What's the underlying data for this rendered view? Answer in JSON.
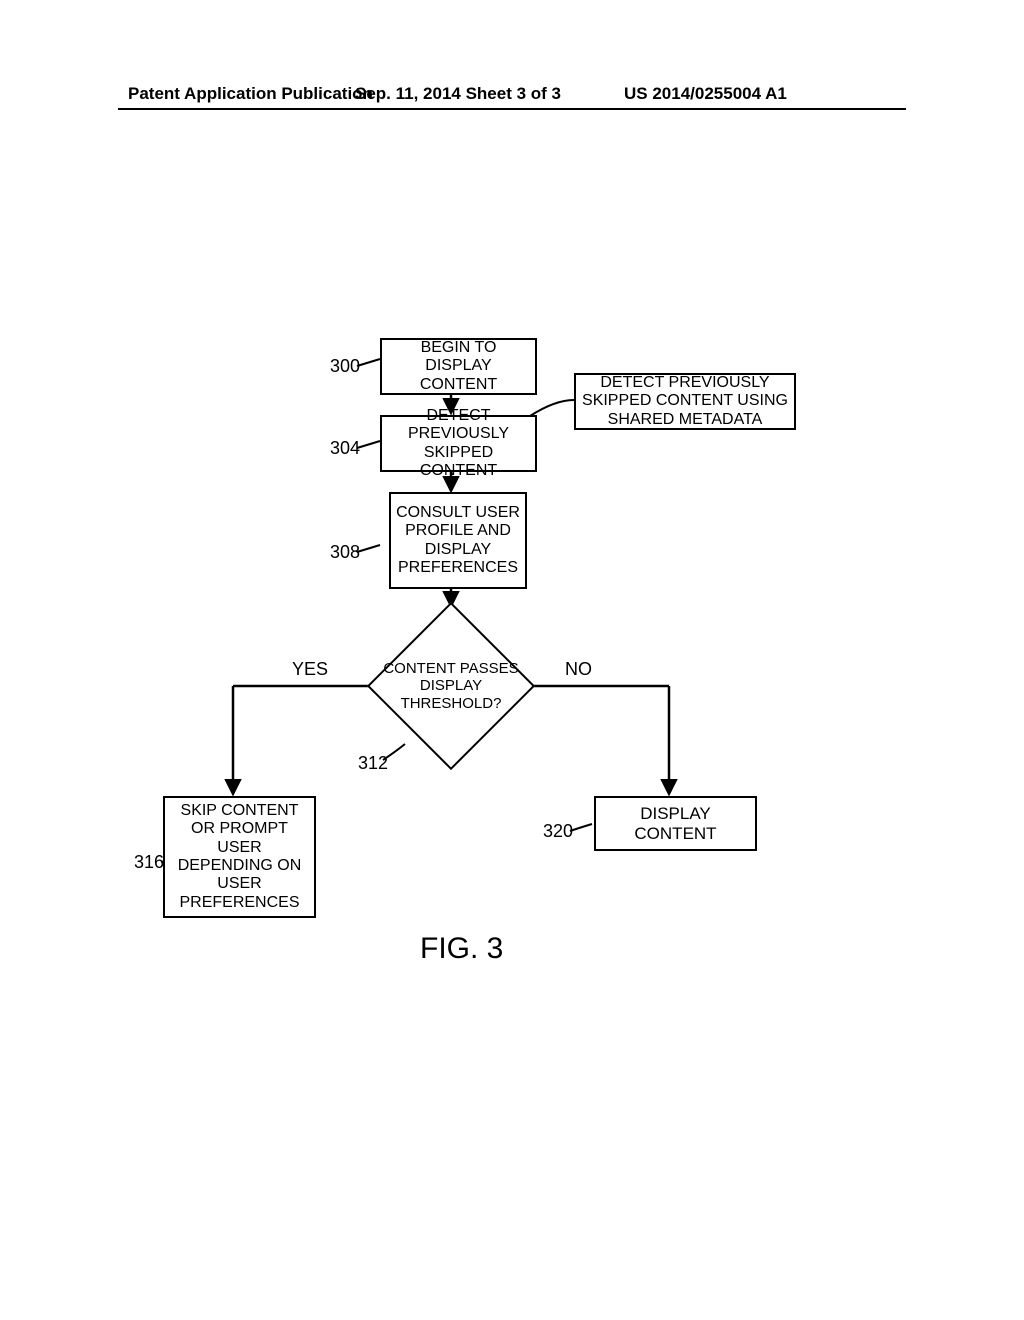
{
  "header": {
    "left": "Patent Application Publication",
    "mid": "Sep. 11, 2014  Sheet 3 of 3",
    "right": "US 2014/0255004 A1"
  },
  "flowchart": {
    "box300_ref": "300",
    "box300_text": "BEGIN TO DISPLAY CONTENT",
    "box304_ref": "304",
    "box304_text": "DETECT PREVIOUSLY SKIPPED CONTENT",
    "side_note": "DETECT PREVIOUSLY SKIPPED CONTENT USING SHARED METADATA",
    "box308_ref": "308",
    "box308_text": "CONSULT USER PROFILE AND DISPLAY PREFERENCES",
    "diamond312_ref": "312",
    "diamond312_text": "CONTENT PASSES DISPLAY THRESHOLD?",
    "branch_yes": "YES",
    "branch_no": "NO",
    "box316_ref": "316",
    "box316_text": "SKIP CONTENT OR PROMPT USER DEPENDING ON USER PREFERENCES",
    "box320_ref": "320",
    "box320_text": "DISPLAY CONTENT"
  },
  "figure_caption": "FIG. 3"
}
